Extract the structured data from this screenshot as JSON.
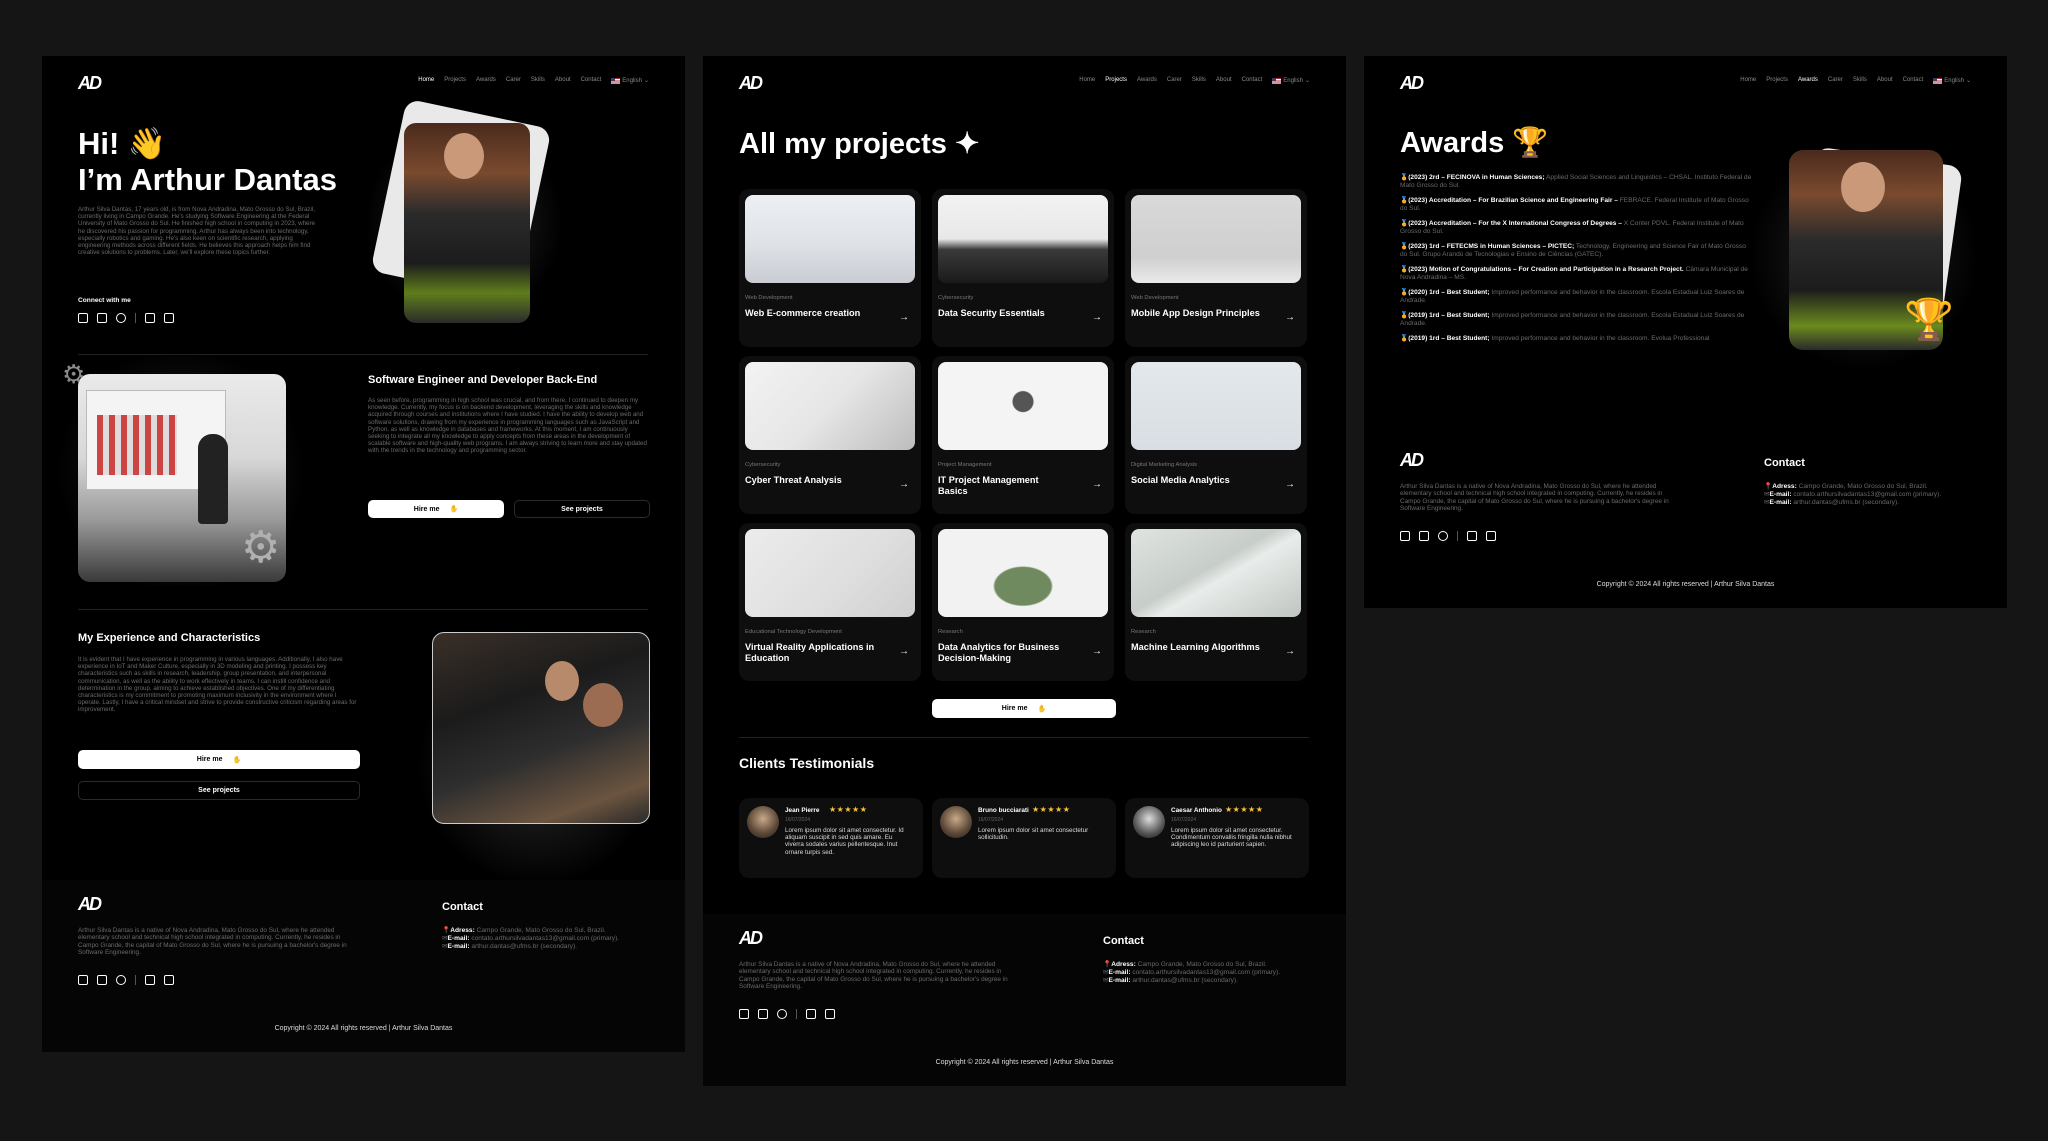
{
  "brand": "AD",
  "colors": {
    "bg": "#151515",
    "panel": "#000000",
    "card": "#0e0e0e",
    "muted": "#6a6a6a",
    "star": "#f6c238"
  },
  "nav": {
    "items": [
      "Home",
      "Projects",
      "Awards",
      "Carer",
      "Skills",
      "About",
      "Contact"
    ],
    "language": "English"
  },
  "home": {
    "hi": "Hi! 👋",
    "name": "I’m Arthur Dantas",
    "intro": "Arthur Silva Dantas, 17 years old, is from Nova Andradina, Mato Grosso do Sul, Brazil, currently living in Campo Grande. He's studying Software Engineering at the Federal University of Mato Grosso do Sul. He finished high school in computing in 2023, where he discovered his passion for programming. Arthur has always been into technology, especially robotics and gaming. He's also keen on scientific research, applying engineering methods across different fields. He believes this approach helps him find creative solutions to problems. Later, we'll explore these topics further.",
    "connect": "Connect with me",
    "section2_title": "Software Engineer and Developer Back-End",
    "section2_text": "As seen before, programming in high school was crucial, and from there, I continued to deepen my knowledge. Currently, my focus is on backend development, leveraging the skills and knowledge acquired through courses and institutions where I have studied. I have the ability to develop web and software solutions, drawing from my experience in programming languages such as JavaScript and Python, as well as knowledge in databases and frameworks. At this moment, I am continuously seeking to integrate all my knowledge to apply concepts from these areas in the development of scalable software and high-quality web programs. I am always striving to learn more and stay updated with the trends in the technology and programming sector.",
    "hire": "Hire me",
    "see_projects": "See projects",
    "section3_title": "My Experience and Characteristics",
    "section3_text": "It is evident that I have experience in programming in various languages. Additionally, I also have experience in IoT and Maker Culture, especially in 3D modeling and printing. I possess key characteristics such as skills in research, leadership, group presentation, and interpersonal communication, as well as the ability to work effectively in teams. I can instill confidence and determination in the group, aiming to achieve established objectives. One of my differentiating characteristics is my commitment to promoting maximum inclusivity in the environment where I operate. Lastly, I have a critical mindset and strive to provide constructive criticism regarding areas for improvement."
  },
  "projects": {
    "title": "All my projects ✦",
    "cards": [
      {
        "cat": "Web Development",
        "title": "Web E-commerce creation"
      },
      {
        "cat": "Cybersecurity",
        "title": "Data Security Essentials"
      },
      {
        "cat": "Web Development",
        "title": "Mobile App Design Principles"
      },
      {
        "cat": "Cybersecurity",
        "title": "Cyber Threat Analysis"
      },
      {
        "cat": "Project Management",
        "title": "IT Project Management Basics"
      },
      {
        "cat": "Digital Marketing Analysis",
        "title": "Social Media Analytics"
      },
      {
        "cat": "Educational Technology Development",
        "title": "Virtual Reality Applications in Education"
      },
      {
        "cat": "Research",
        "title": "Data Analytics for Business Decision-Making"
      },
      {
        "cat": "Research",
        "title": "Machine Learning Algorithms"
      }
    ],
    "hire": "Hire me",
    "testimonials_title": "Clients Testimonials",
    "testimonials": [
      {
        "name": "Jean Pierre",
        "stars": "★★★★★",
        "date": "16/07/2024",
        "text": "Lorem ipsum dolor sit amet consectetur. Id aliquam suscipit in sed quis amare. Eu viverra sodales varius pellentesque. Inut ornare turpis sed."
      },
      {
        "name": "Bruno bucciarati",
        "stars": "★★★★★",
        "date": "16/07/2024",
        "text": "Lorem ipsum dolor sit amet consectetur sollicitudin."
      },
      {
        "name": "Caesar Anthonio",
        "stars": "★★★★★",
        "date": "16/07/2024",
        "text": "Lorem ipsum dolor sit amet consectetur. Condimentum convallis fringilla nulla nibhut adipiscing leo id parturient sapien."
      }
    ]
  },
  "awards": {
    "title": "Awards 🏆",
    "items": [
      {
        "bold": "(2023) 2rd – FECINOVA in Human Sciences;",
        "rest": " Applied Social Sciences and Linguistics – CHSAL. Instituto Federal de Mato Grosso do Sul."
      },
      {
        "bold": "(2023) Accreditation – For Brazilian Science and Engineering Fair –",
        "rest": " FEBRACE. Federal Institute of Mato Grosso do Sul."
      },
      {
        "bold": "(2023) Accreditation – For the X International Congress of Degrees –",
        "rest": " X Conter PDVL. Federal Institute of Mato Grosso do Sul."
      },
      {
        "bold": "(2023) 1rd – FETECMS in Human Sciences – PICTEC;",
        "rest": " Technology, Engineering and Science Fair of Mato Grosso do Sul. Grupo Arandú de Tecnologias e Ensino de Ciências (GATEC)."
      },
      {
        "bold": "(2023) Motion of Congratulations – For Creation and Participation in a Research Project.",
        "rest": " Câmara Municipal de Nova Andradina – MS."
      },
      {
        "bold": "(2020) 1rd – Best Student;",
        "rest": " Improved performance and behavior in the classroom. Escola Estadual Luiz Soares de Andrade."
      },
      {
        "bold": "(2019) 1rd – Best Student;",
        "rest": " Improved performance and behavior in the classroom. Escola Estadual Luiz Soares de Andrade."
      },
      {
        "bold": "(2019) 1rd – Best Student;",
        "rest": " Improved performance and behavior in the classroom. Evolua Professional"
      }
    ]
  },
  "footer": {
    "bio": "Arthur Silva Dantas is a native of Nova Andradina, Mato Grosso do Sul, where he attended elementary school and technical high school integrated in computing. Currently, he resides in Campo Grande, the capital of Mato Grosso do Sul, where he is pursuing a bachelor's degree in Software Engineering.",
    "contact_title": "Contact",
    "address_label": "Adress:",
    "address": " Campo Grande, Mato Grosso do Sul, Brazil.",
    "email_label": "E-mail:",
    "email1": " contato.arthursilvadantas13@gmail.com (primary).",
    "email2": " arthur.dantas@ufms.br (secondary).",
    "copyright": "Copyright © 2024 All rights reserved | Arthur Silva Dantas"
  }
}
